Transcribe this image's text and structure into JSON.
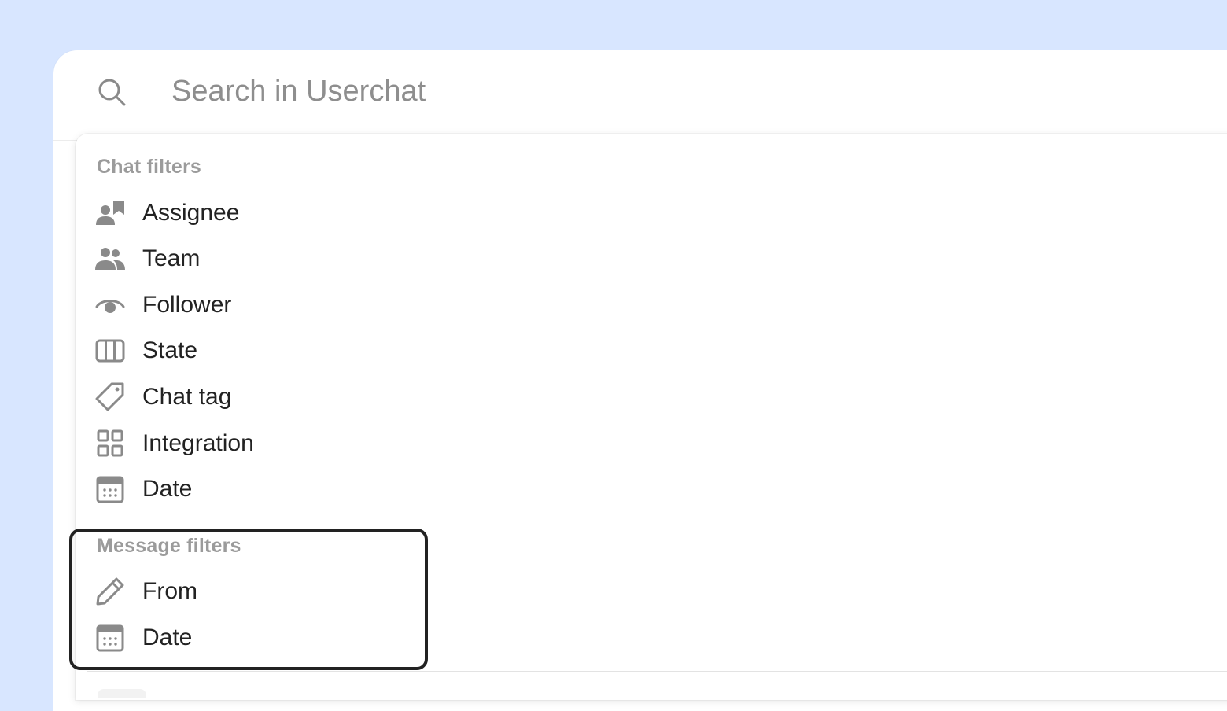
{
  "search": {
    "placeholder": "Search in Userchat"
  },
  "chat_filters": {
    "title": "Chat filters",
    "items": [
      {
        "label": "Assignee",
        "icon": "assignee-icon"
      },
      {
        "label": "Team",
        "icon": "team-icon"
      },
      {
        "label": "Follower",
        "icon": "eye-icon"
      },
      {
        "label": "State",
        "icon": "columns-icon"
      },
      {
        "label": "Chat tag",
        "icon": "tag-icon"
      },
      {
        "label": "Integration",
        "icon": "grid-icon"
      },
      {
        "label": "Date",
        "icon": "calendar-icon"
      }
    ]
  },
  "message_filters": {
    "title": "Message filters",
    "items": [
      {
        "label": "From",
        "icon": "pencil-icon"
      },
      {
        "label": "Date",
        "icon": "calendar-icon"
      }
    ]
  },
  "colors": {
    "background": "#d8e6ff",
    "icon": "#8a8a8a",
    "text": "#222222",
    "section_title": "#9b9b9b",
    "highlight_border": "#222222"
  }
}
